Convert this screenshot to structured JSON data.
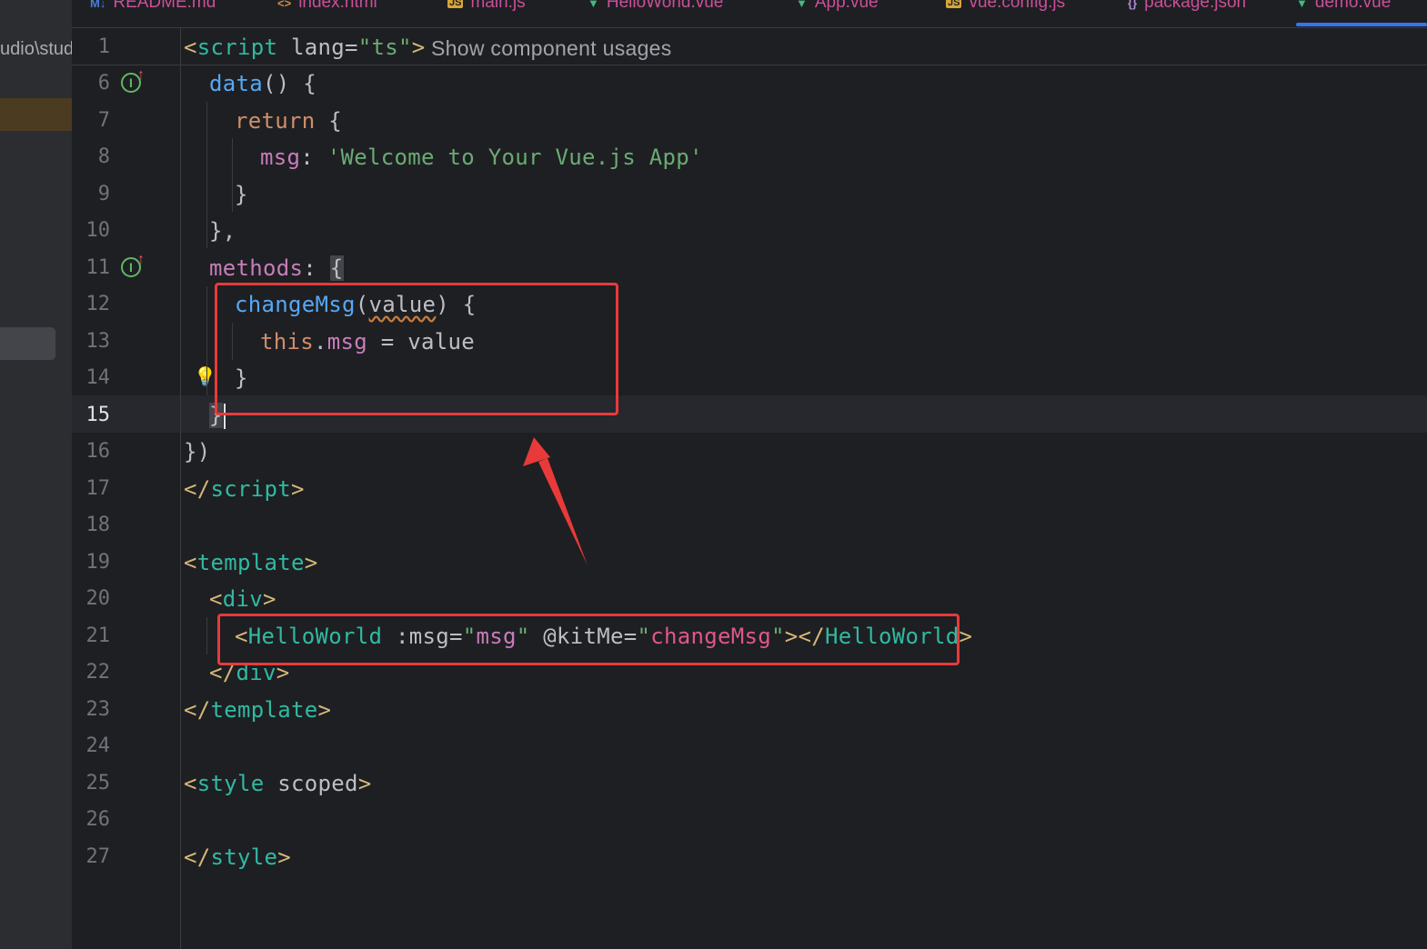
{
  "sidebar": {
    "path_fragment": "udio\\stud"
  },
  "tabs": [
    {
      "icon": "M↓",
      "icon_kind": "md",
      "label": "README.md"
    },
    {
      "icon": "<>",
      "icon_kind": "html",
      "label": "index.html"
    },
    {
      "icon": "JS",
      "icon_kind": "js",
      "label": "main.js"
    },
    {
      "icon": "▼",
      "icon_kind": "vue",
      "label": "HelloWorld.vue"
    },
    {
      "icon": "▼",
      "icon_kind": "vue",
      "label": "App.vue"
    },
    {
      "icon": "JS",
      "icon_kind": "js",
      "label": "vue.config.js"
    },
    {
      "icon": "{}",
      "icon_kind": "json",
      "label": "package.json"
    },
    {
      "icon": "▼",
      "icon_kind": "vue",
      "label": "demo.vue",
      "active": true
    }
  ],
  "editor": {
    "sticky_line_number": "1",
    "sticky_hint": "Show component usages",
    "current_line": "15",
    "lines": [
      {
        "n": "6",
        "tokens": [
          [
            "fn",
            "data"
          ],
          [
            "plain",
            "() {"
          ]
        ]
      },
      {
        "n": "7",
        "tokens": [
          [
            "kw",
            "return"
          ],
          [
            "plain",
            " {"
          ]
        ]
      },
      {
        "n": "8",
        "tokens": [
          [
            "prop",
            "msg"
          ],
          [
            "plain",
            ": "
          ],
          [
            "str",
            "'Welcome to Your Vue.js App'"
          ]
        ]
      },
      {
        "n": "9",
        "tokens": [
          [
            "plain",
            "}"
          ]
        ]
      },
      {
        "n": "10",
        "tokens": [
          [
            "plain",
            "},"
          ]
        ]
      },
      {
        "n": "11",
        "tokens": [
          [
            "prop",
            "methods"
          ],
          [
            "plain",
            ": "
          ],
          [
            "brace",
            "{"
          ]
        ]
      },
      {
        "n": "12",
        "tokens": [
          [
            "fn",
            "changeMsg"
          ],
          [
            "plain",
            "("
          ],
          [
            "squig",
            "value"
          ],
          [
            "plain",
            ") {"
          ]
        ]
      },
      {
        "n": "13",
        "tokens": [
          [
            "kw",
            "this"
          ],
          [
            "plain",
            "."
          ],
          [
            "prop",
            "msg"
          ],
          [
            "plain",
            " = value"
          ]
        ]
      },
      {
        "n": "14",
        "tokens": [
          [
            "plain",
            "}"
          ]
        ]
      },
      {
        "n": "15",
        "tokens": [
          [
            "brace",
            "}"
          ]
        ]
      },
      {
        "n": "16",
        "tokens": [
          [
            "plain",
            "})"
          ]
        ]
      },
      {
        "n": "17",
        "tokens": [
          [
            "tag",
            "</"
          ],
          [
            "name",
            "script"
          ],
          [
            "tag",
            ">"
          ]
        ]
      },
      {
        "n": "18",
        "tokens": []
      },
      {
        "n": "19",
        "tokens": [
          [
            "tag",
            "<"
          ],
          [
            "name",
            "template"
          ],
          [
            "tag",
            ">"
          ]
        ]
      },
      {
        "n": "20",
        "tokens": [
          [
            "tag",
            "<"
          ],
          [
            "name",
            "div"
          ],
          [
            "tag",
            ">"
          ]
        ]
      },
      {
        "n": "21",
        "tokens": [
          [
            "tag",
            "<"
          ],
          [
            "comp",
            "HelloWorld"
          ],
          [
            "attr",
            " :msg="
          ],
          [
            "str",
            "\""
          ],
          [
            "prop",
            "msg"
          ],
          [
            "str",
            "\""
          ],
          [
            "attr",
            " @kitMe="
          ],
          [
            "str",
            "\""
          ],
          [
            "pink",
            "changeMsg"
          ],
          [
            "str",
            "\""
          ],
          [
            "tag",
            "></"
          ],
          [
            "comp",
            "HelloWorld"
          ],
          [
            "tag",
            ">"
          ]
        ]
      },
      {
        "n": "22",
        "tokens": [
          [
            "tag",
            "</"
          ],
          [
            "name",
            "div"
          ],
          [
            "tag",
            ">"
          ]
        ]
      },
      {
        "n": "23",
        "tokens": [
          [
            "tag",
            "</"
          ],
          [
            "name",
            "template"
          ],
          [
            "tag",
            ">"
          ]
        ]
      },
      {
        "n": "24",
        "tokens": []
      },
      {
        "n": "25",
        "tokens": [
          [
            "tag",
            "<"
          ],
          [
            "name",
            "style"
          ],
          [
            "attr",
            " scoped"
          ],
          [
            "tag",
            ">"
          ]
        ]
      },
      {
        "n": "26",
        "tokens": []
      },
      {
        "n": "27",
        "tokens": [
          [
            "tag",
            "</"
          ],
          [
            "name",
            "style"
          ],
          [
            "tag",
            ">"
          ]
        ]
      }
    ]
  },
  "sticky_tokens": [
    [
      "tag",
      "<"
    ],
    [
      "name",
      "script"
    ],
    [
      "attr",
      " lang="
    ],
    [
      "str",
      "\"ts\""
    ],
    [
      "tag",
      ">"
    ]
  ],
  "gutter_icon_letter": "I",
  "gutter_icon_arrow": "↑",
  "bulb_glyph": "💡",
  "colors": {
    "annotation_red": "#e83a3a",
    "editor_bg": "#1e1f22",
    "current_line_bg": "#26282e"
  }
}
